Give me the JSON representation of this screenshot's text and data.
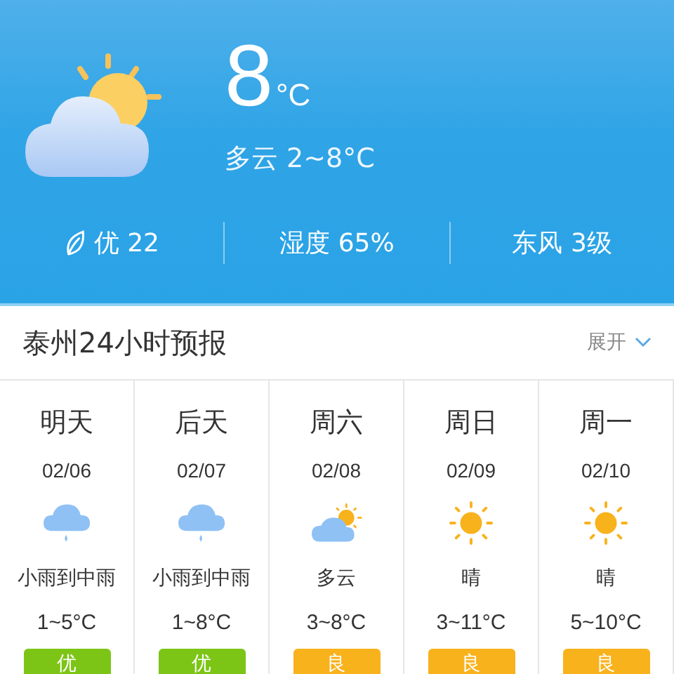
{
  "current": {
    "temperature": "8",
    "unit": "°C",
    "summary": "多云 2~8°C",
    "stats": [
      {
        "kind": "air",
        "text": "优 22"
      },
      {
        "kind": "plain",
        "text": "湿度 65%"
      },
      {
        "kind": "plain",
        "text": "东风 3级"
      }
    ]
  },
  "forecast": {
    "title": "泰州24小时预报",
    "expand": "展开",
    "days": [
      {
        "day": "明天",
        "date": "02/06",
        "kind": "rain",
        "desc": "小雨到中雨",
        "temp": "1~5°C",
        "air": "优",
        "color": "#7cc516"
      },
      {
        "day": "后天",
        "date": "02/07",
        "kind": "rain",
        "desc": "小雨到中雨",
        "temp": "1~8°C",
        "air": "优",
        "color": "#7cc516"
      },
      {
        "day": "周六",
        "date": "02/08",
        "kind": "partly_cloudy",
        "desc": "多云",
        "temp": "3~8°C",
        "air": "良",
        "color": "#f8b21c"
      },
      {
        "day": "周日",
        "date": "02/09",
        "kind": "sunny",
        "desc": "晴",
        "temp": "3~11°C",
        "air": "良",
        "color": "#f8b21c"
      },
      {
        "day": "周一",
        "date": "02/10",
        "kind": "sunny",
        "desc": "晴",
        "temp": "5~10°C",
        "air": "良",
        "color": "#f8b21c"
      }
    ]
  }
}
